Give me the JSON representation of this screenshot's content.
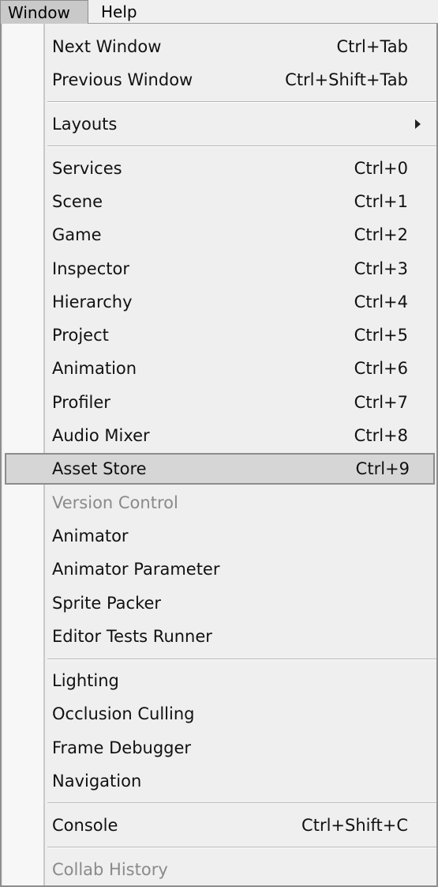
{
  "menubar": {
    "window_label": "Window",
    "help_label": "Help"
  },
  "menu": {
    "next_window": {
      "label": "Next Window",
      "shortcut": "Ctrl+Tab"
    },
    "previous_window": {
      "label": "Previous Window",
      "shortcut": "Ctrl+Shift+Tab"
    },
    "layouts": {
      "label": "Layouts"
    },
    "services": {
      "label": "Services",
      "shortcut": "Ctrl+0"
    },
    "scene": {
      "label": "Scene",
      "shortcut": "Ctrl+1"
    },
    "game": {
      "label": "Game",
      "shortcut": "Ctrl+2"
    },
    "inspector": {
      "label": "Inspector",
      "shortcut": "Ctrl+3"
    },
    "hierarchy": {
      "label": "Hierarchy",
      "shortcut": "Ctrl+4"
    },
    "project": {
      "label": "Project",
      "shortcut": "Ctrl+5"
    },
    "animation": {
      "label": "Animation",
      "shortcut": "Ctrl+6"
    },
    "profiler": {
      "label": "Profiler",
      "shortcut": "Ctrl+7"
    },
    "audio_mixer": {
      "label": "Audio Mixer",
      "shortcut": "Ctrl+8"
    },
    "asset_store": {
      "label": "Asset Store",
      "shortcut": "Ctrl+9"
    },
    "version_control": {
      "label": "Version Control"
    },
    "animator": {
      "label": "Animator"
    },
    "animator_parameter": {
      "label": "Animator Parameter"
    },
    "sprite_packer": {
      "label": "Sprite Packer"
    },
    "editor_tests_runner": {
      "label": "Editor Tests Runner"
    },
    "lighting": {
      "label": "Lighting"
    },
    "occlusion_culling": {
      "label": "Occlusion Culling"
    },
    "frame_debugger": {
      "label": "Frame Debugger"
    },
    "navigation": {
      "label": "Navigation"
    },
    "console": {
      "label": "Console",
      "shortcut": "Ctrl+Shift+C"
    },
    "collab_history": {
      "label": "Collab History"
    }
  }
}
